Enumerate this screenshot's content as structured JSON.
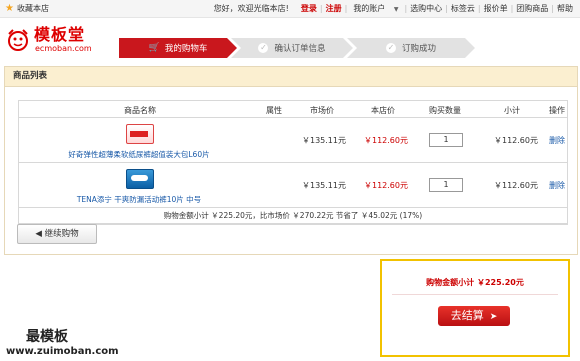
{
  "topbar": {
    "favorite": "收藏本店",
    "welcome": "您好，欢迎光临本店!",
    "login": "登录",
    "register": "注册",
    "links": [
      "我的账户",
      "选购中心",
      "标签云",
      "报价单",
      "团购商品",
      "帮助"
    ]
  },
  "logo": {
    "cn": "模板堂",
    "en": "ecmoban.com"
  },
  "steps": [
    "我的购物车",
    "确认订单信息",
    "订购成功"
  ],
  "panel_title": "商品列表",
  "table": {
    "headers": [
      "商品名称",
      "属性",
      "市场价",
      "本店价",
      "购买数量",
      "小计",
      "操作"
    ],
    "rows": [
      {
        "name": "好奇弹性超薄柔软纸尿裤超值装大包L60片",
        "attr": "",
        "market": "￥135.11元",
        "price": "￥112.60元",
        "qty": "1",
        "subtotal": "￥112.60元",
        "action": "删除"
      },
      {
        "name": "TENA添宁 干爽防漏活动裤10片 中号",
        "attr": "",
        "market": "￥135.11元",
        "price": "￥112.60元",
        "qty": "1",
        "subtotal": "￥112.60元",
        "action": "删除"
      }
    ],
    "summary": "购物金额小计 ￥225.20元，比市场价 ￥270.22元 节省了 ￥45.02元 (17%)"
  },
  "continue_button": "继续购物",
  "checkout": {
    "total_text": "购物金额小计 ￥225.20元",
    "button": "去结算"
  },
  "watermark": {
    "title": "最模板",
    "url": "www.zuimoban.com"
  },
  "colors": {
    "brand_red": "#c9171d",
    "panel_header": "#fbefd0",
    "checkout_border": "#f2c200",
    "link_blue": "#1a5aa8"
  },
  "icons": [
    "star-icon",
    "cart-icon",
    "check-icon",
    "arrow-left-icon",
    "arrow-right-icon"
  ]
}
